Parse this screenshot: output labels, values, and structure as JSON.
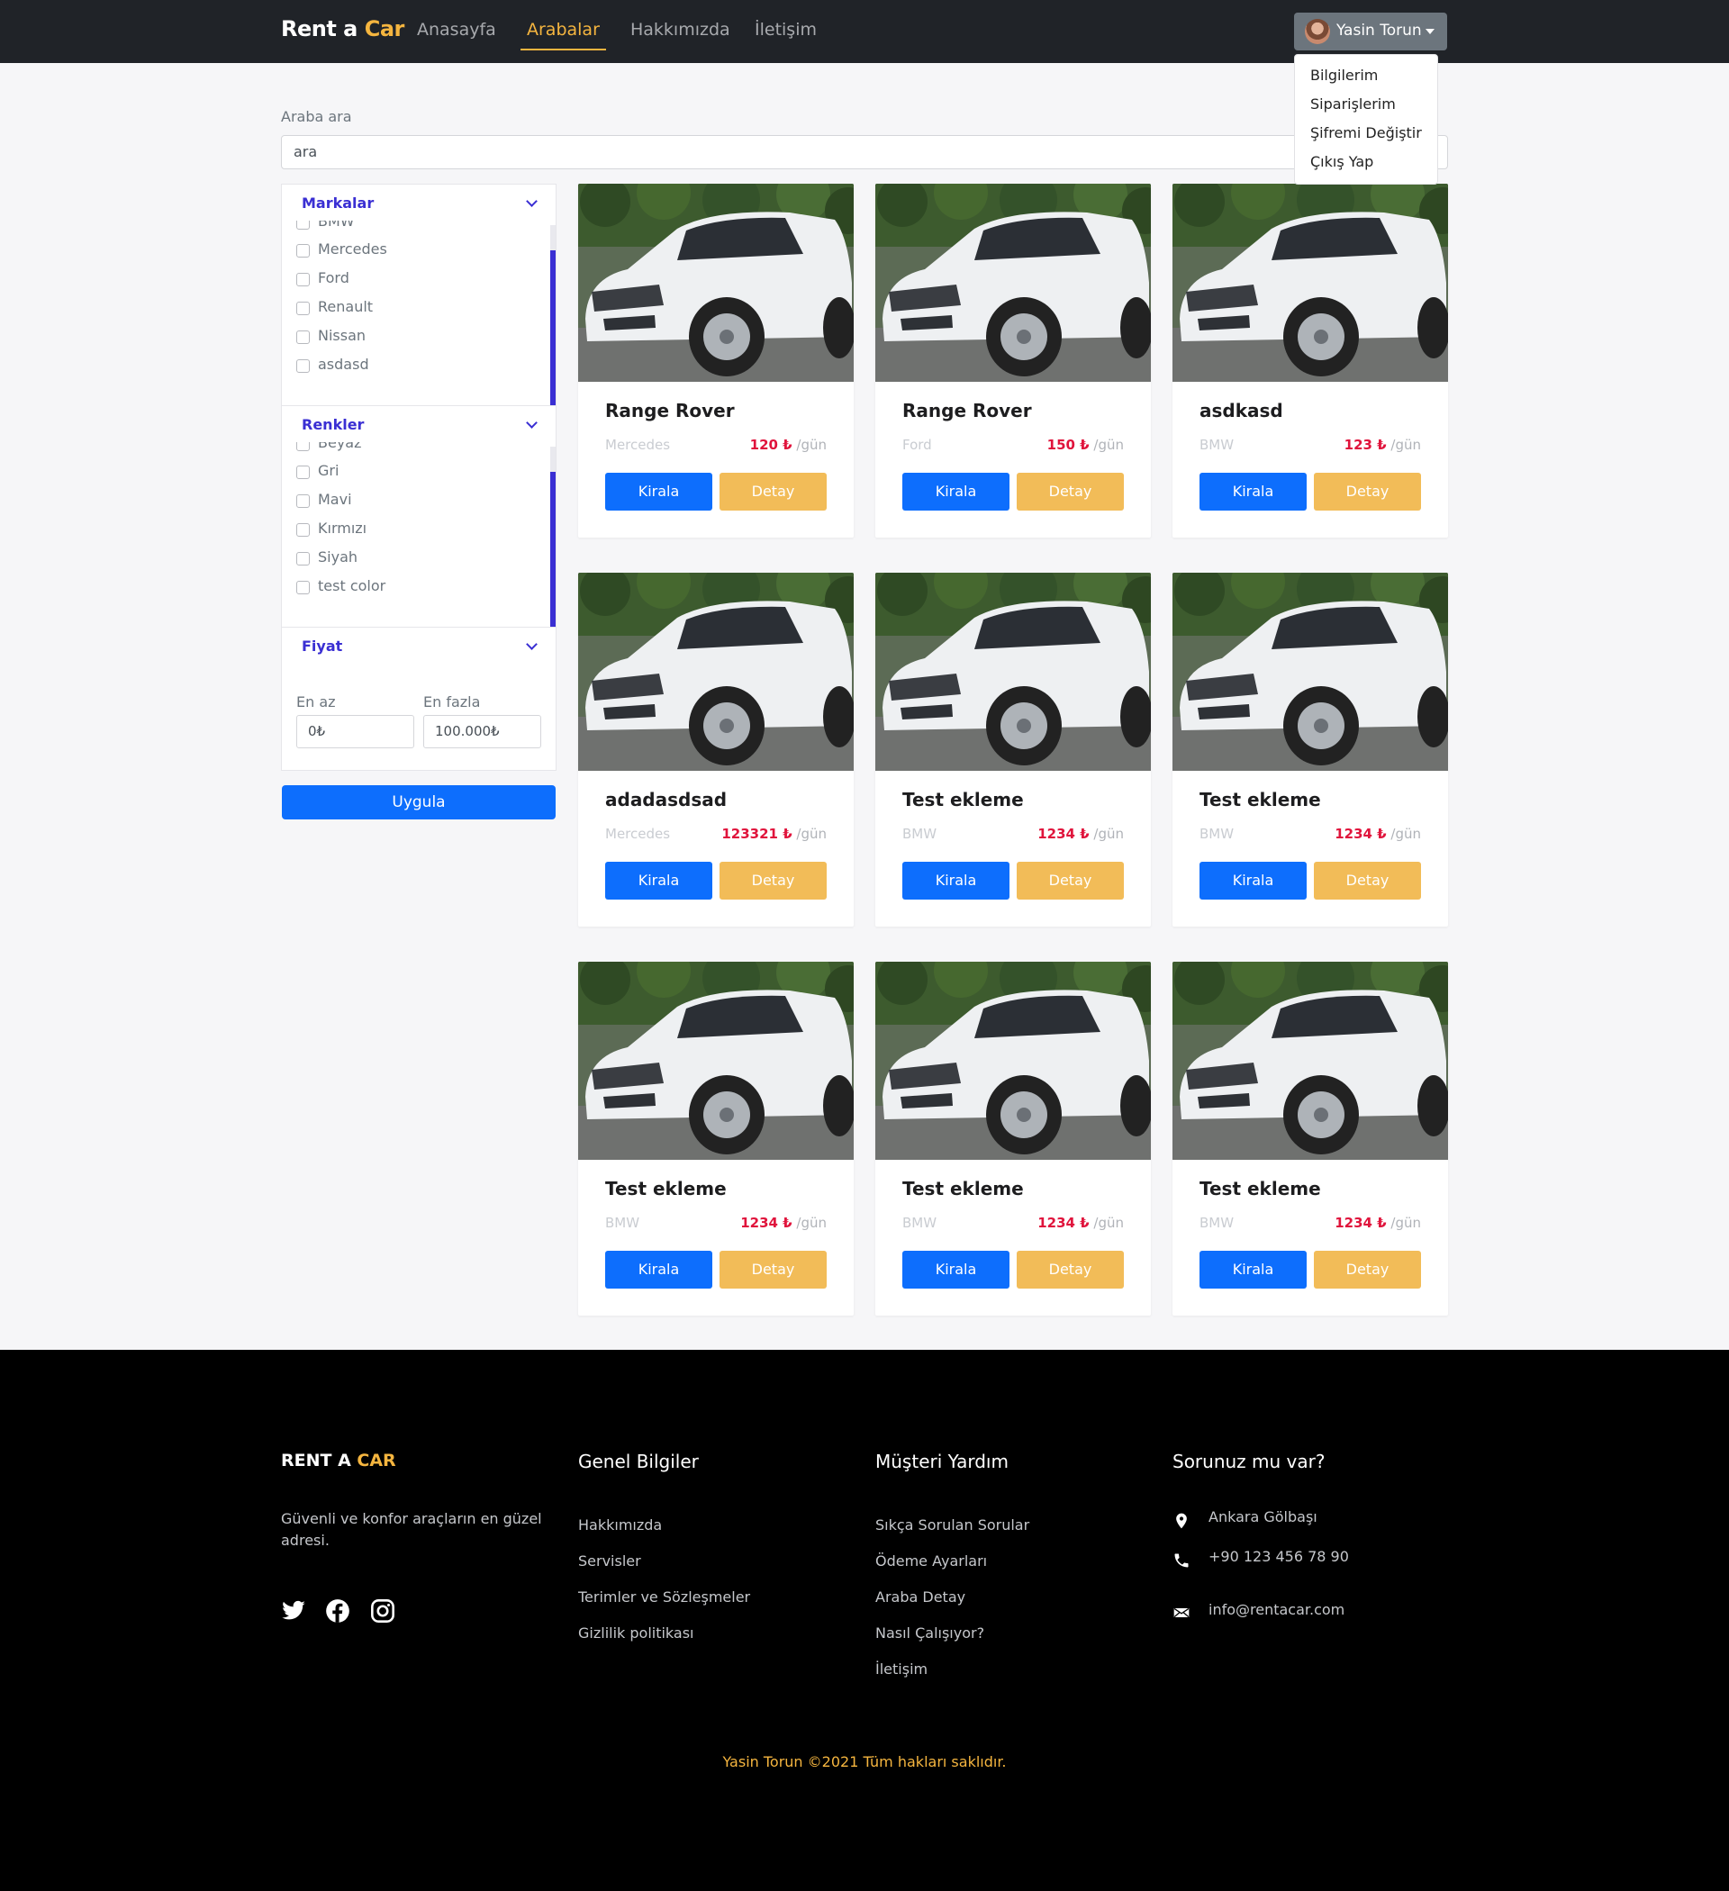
{
  "navbar": {
    "brand_part1": "Rent a ",
    "brand_part2": "Car",
    "links": [
      "Anasayfa",
      "Arabalar",
      "Hakkımızda",
      "İletişim"
    ],
    "active_link": "Arabalar",
    "user_name": "Yasin Torun"
  },
  "user_menu": {
    "items": [
      "Bilgilerim",
      "Siparişlerim",
      "Şifremi Değiştir",
      "Çıkış Yap"
    ]
  },
  "search": {
    "label": "Araba ara",
    "placeholder": "ara"
  },
  "filters": {
    "brands": {
      "title": "Markalar",
      "options": [
        "BMW",
        "Mercedes",
        "Ford",
        "Renault",
        "Nissan",
        "asdasd"
      ]
    },
    "colors": {
      "title": "Renkler",
      "options": [
        "Beyaz",
        "Gri",
        "Mavi",
        "Kırmızı",
        "Siyah",
        "test color"
      ]
    },
    "price": {
      "title": "Fiyat",
      "min_label": "En az",
      "max_label": "En fazla",
      "min_placeholder": "0₺",
      "max_placeholder": "100.000₺"
    },
    "apply_label": "Uygula"
  },
  "cars": [
    {
      "name": "Range Rover",
      "brand": "Mercedes",
      "price": "120 ₺",
      "unit": "/gün"
    },
    {
      "name": "Range Rover",
      "brand": "Ford",
      "price": "150 ₺",
      "unit": "/gün"
    },
    {
      "name": "asdkasd",
      "brand": "BMW",
      "price": "123 ₺",
      "unit": "/gün"
    },
    {
      "name": "adadasdsad",
      "brand": "Mercedes",
      "price": "123321 ₺",
      "unit": "/gün"
    },
    {
      "name": "Test ekleme",
      "brand": "BMW",
      "price": "1234 ₺",
      "unit": "/gün"
    },
    {
      "name": "Test ekleme",
      "brand": "BMW",
      "price": "1234 ₺",
      "unit": "/gün"
    },
    {
      "name": "Test ekleme",
      "brand": "BMW",
      "price": "1234 ₺",
      "unit": "/gün"
    },
    {
      "name": "Test ekleme",
      "brand": "BMW",
      "price": "1234 ₺",
      "unit": "/gün"
    },
    {
      "name": "Test ekleme",
      "brand": "BMW",
      "price": "1234 ₺",
      "unit": "/gün"
    }
  ],
  "card_buttons": {
    "rent": "Kirala",
    "detail": "Detay"
  },
  "footer": {
    "brand_part1": "RENT A ",
    "brand_part2": "CAR",
    "tagline": "Güvenli ve konfor araçların en güzel adresi.",
    "col_general": {
      "title": "Genel Bilgiler",
      "links": [
        "Hakkımızda",
        "Servisler",
        "Terimler ve Sözleşmeler",
        "Gizlilik politikası"
      ]
    },
    "col_help": {
      "title": "Müşteri Yardım",
      "links": [
        "Sıkça Sorulan Sorular",
        "Ödeme Ayarları",
        "Araba Detay",
        "Nasıl Çalışıyor?",
        "İletişim"
      ]
    },
    "col_contact": {
      "title": "Sorunuz mu var?",
      "address": "Ankara Gölbaşı",
      "phone": "+90 123 456 78 90",
      "email": "info@rentacar.com"
    },
    "copyright": "Yasin Torun ©2021 Tüm hakları saklıdır."
  },
  "colors": {
    "primary": "#0d6efd",
    "accent": "#f5b53f",
    "price": "#e0143c",
    "filter_title": "#3a2fd3"
  }
}
